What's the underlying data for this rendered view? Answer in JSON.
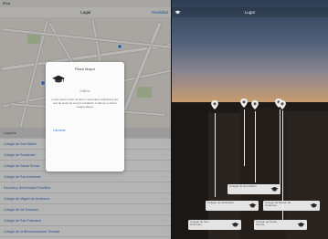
{
  "left_panel": {
    "status": "iPad",
    "nav_title": "Lugar",
    "nav_action": "Realidad",
    "table_header": "Lugares",
    "rows": [
      "Colegio de San Martín",
      "Colegio de Santander",
      "Colegio de Santa Teresa",
      "Colegio de San Ambrosio",
      "Escuela y Universidad Pontificia",
      "Colegio de Miguel de Unamuno",
      "Colegio de los Doctores",
      "Colegio de San Francisco",
      "Colegio de la Bienaventurada Trinidad"
    ]
  },
  "popup": {
    "title": "Plaza Mayor",
    "subtitle": "Edificio",
    "body": "Lorem ipsum dolor sit amet, consectetur adipiscing elit, sed do eiusmod tempor incididunt ut labore et dolore magna aliqua.",
    "link": "Llévame"
  },
  "right_panel": {
    "nav_title": "Lugar",
    "back_icon": "graduation-cap-icon",
    "cards": [
      {
        "label": "Colegio de San Ambrosio"
      },
      {
        "label": "Colegio de Santa Teresa"
      },
      {
        "label": "Colegio de Miguel de Unamuno"
      },
      {
        "label": "Colegio de Santander"
      },
      {
        "label": "Colegio de San Martín"
      }
    ]
  },
  "colors": {
    "accent": "#3b7ad8",
    "sunset": "#e1b27a"
  }
}
